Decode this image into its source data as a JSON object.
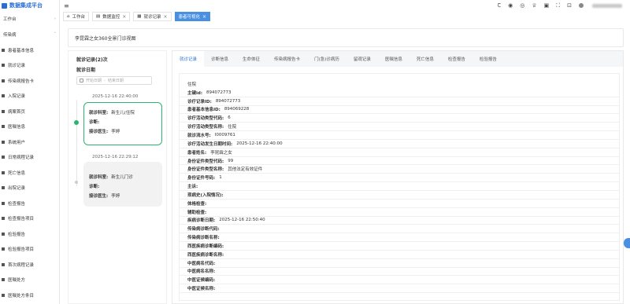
{
  "app": {
    "title": "数据集成平台"
  },
  "sidebar": {
    "groups": [
      {
        "label": "工作台"
      },
      {
        "label": "传染病"
      }
    ],
    "items": [
      {
        "label": "患者基本信息"
      },
      {
        "label": "就诊记录"
      },
      {
        "label": "传染病报告卡"
      },
      {
        "label": "入院记录"
      },
      {
        "label": "病案首页"
      },
      {
        "label": "医嘱信息"
      },
      {
        "label": "系统用户"
      },
      {
        "label": "日常病程记录"
      },
      {
        "label": "死亡信息"
      },
      {
        "label": "出院记录"
      },
      {
        "label": "检查报告"
      },
      {
        "label": "检查报告项目"
      },
      {
        "label": "检验报告"
      },
      {
        "label": "检验报告项目"
      },
      {
        "label": "首次病程记录"
      },
      {
        "label": "医嘱处方"
      },
      {
        "label": "医嘱处方条目"
      }
    ]
  },
  "page_tabs": [
    {
      "label": "工作台",
      "icon": "home-icon",
      "closable": false,
      "active": false
    },
    {
      "label": "数据监控",
      "icon": "chart-icon",
      "closable": true,
      "active": false
    },
    {
      "label": "就诊记录",
      "icon": "doc-icon",
      "closable": true,
      "active": false
    },
    {
      "label": "患者可视化",
      "icon": "",
      "closable": true,
      "active": true
    }
  ],
  "patient_title": "李昆霖之女360全景门诊视图",
  "visits": {
    "title": "就诊记录(2)次",
    "date_label": "就诊日期",
    "start_placeholder": "开始日期",
    "separator": "-",
    "end_placeholder": "结束日期",
    "records": [
      {
        "time": "2025-12-16 22:40:00",
        "dept_label": "就诊科室:",
        "dept": "新生儿(住院",
        "diag_label": "诊断:",
        "diag": "",
        "doctor_label": "接诊医生:",
        "doctor": "李婷"
      },
      {
        "time": "2025-12-16 22:29:12",
        "dept_label": "就诊科室:",
        "dept": "新生儿门诊",
        "diag_label": "诊断:",
        "diag": "",
        "doctor_label": "接诊医生:",
        "doctor": "李婷"
      }
    ]
  },
  "detail_tabs": [
    "就诊记录",
    "诊断信息",
    "生命体征",
    "传染病报告卡",
    "门(急)诊病历",
    "留观记录",
    "医嘱信息",
    "死亡信息",
    "检查报告",
    "检验报告"
  ],
  "detail": {
    "header": "住院",
    "fields": [
      {
        "label": "主键id:",
        "value": "894072773"
      },
      {
        "label": "诊疗记录ID:",
        "value": "894072773"
      },
      {
        "label": "患者基本信息ID:",
        "value": "894069228"
      },
      {
        "label": "诊疗活动类型代码:",
        "value": "6"
      },
      {
        "label": "诊疗活动类型名称:",
        "value": "住院"
      },
      {
        "label": "就诊流水号:",
        "value": "I0009761"
      },
      {
        "label": "诊疗活动发生日期时间:",
        "value": "2025-12-16 22:40:00"
      },
      {
        "label": "患者姓名:",
        "value": "李昆霖之女"
      },
      {
        "label": "身份证件类型代码:",
        "value": "99"
      },
      {
        "label": "身份证件类型名称:",
        "value": "其他法定有效证件"
      },
      {
        "label": "身份证件号码:",
        "value": "1"
      },
      {
        "label": "主诉:",
        "value": ""
      },
      {
        "label": "现病史(入院情况):",
        "value": ""
      },
      {
        "label": "体格检查:",
        "value": ""
      },
      {
        "label": "辅助检查:",
        "value": ""
      },
      {
        "label": "疾病诊断日期:",
        "value": "2025-12-16 22:50:40"
      },
      {
        "label": "传染病诊断代码:",
        "value": ""
      },
      {
        "label": "传染病诊断名称:",
        "value": ""
      },
      {
        "label": "西医疾病诊断编码:",
        "value": ""
      },
      {
        "label": "西医疾病诊断名称:",
        "value": ""
      },
      {
        "label": "中医病名代码:",
        "value": ""
      },
      {
        "label": "中医病名名称:",
        "value": ""
      },
      {
        "label": "中医证候编码:",
        "value": ""
      },
      {
        "label": "中医证候名称:",
        "value": ""
      }
    ]
  },
  "colors": {
    "accent": "#4a90e2",
    "brand": "#2b6fd6",
    "active_card": "#2bb56f"
  }
}
